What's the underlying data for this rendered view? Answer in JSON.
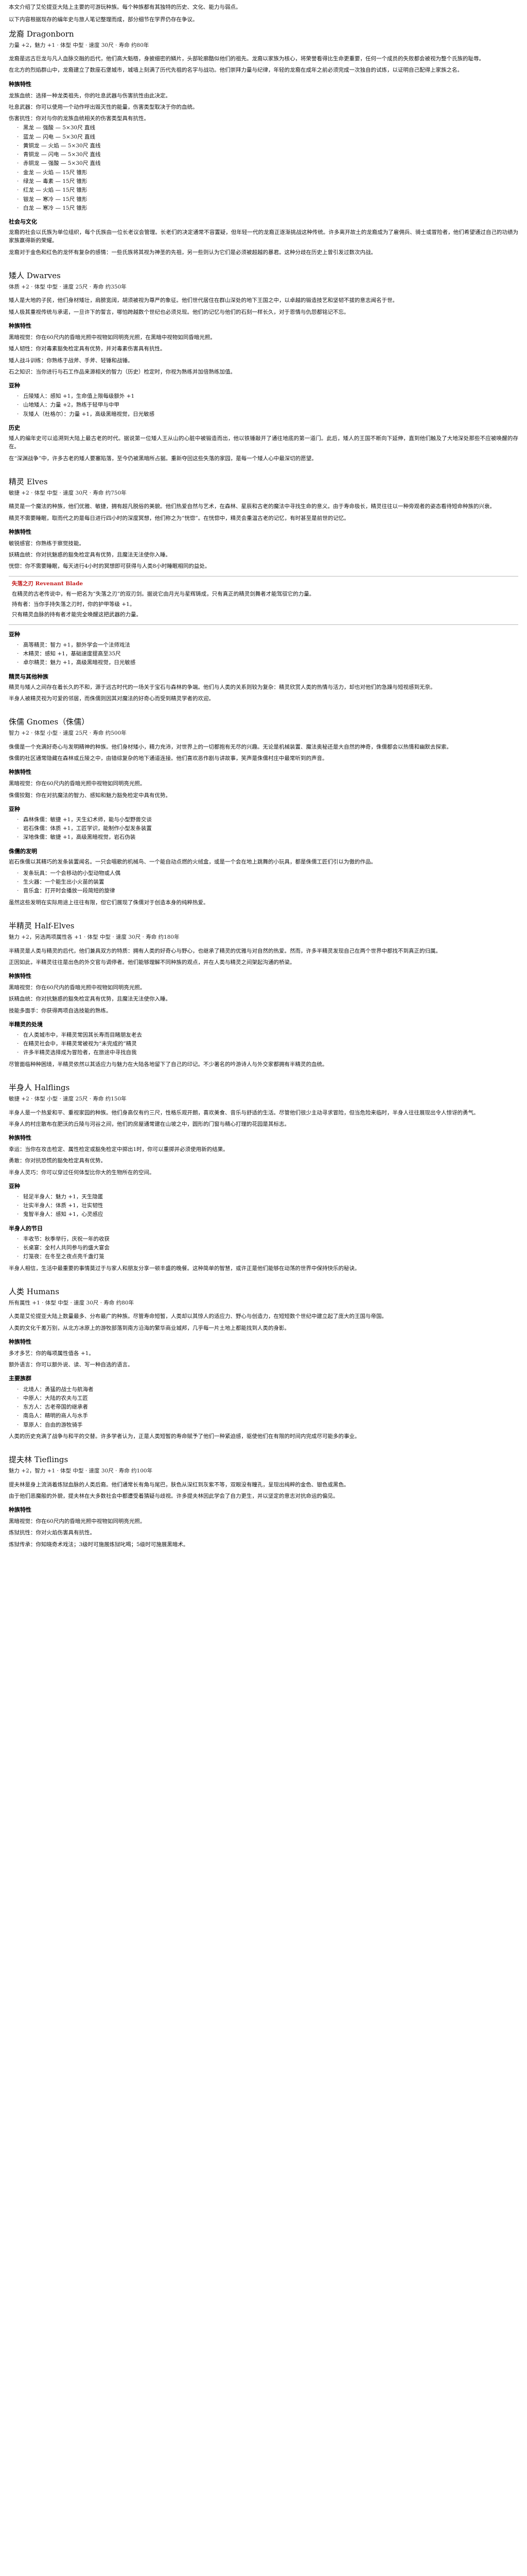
{
  "intro": [
    "本文介绍了艾伦提亚大陆上主要的可游玩种族。每个种族都有其独特的历史、文化、能力与弱点。",
    "以下内容根据现存的编年史与旅人笔记整理而成，部分细节在学界仍存在争议。"
  ],
  "sections": [
    {
      "title": "龙裔 Dragonborn",
      "meta": "力量 +2，魅力 +1 · 体型 中型 · 速度 30尺 · 寿命 约80年",
      "paras": [
        "龙裔是远古巨龙与凡人血脉交融的后代，他们高大魁梧，身披细密的鳞片，头部轮廓酷似他们的祖先。龙裔以家族为核心，将荣誉看得比生命更重要，任何一个成员的失败都会被视为整个氏族的耻辱。",
        "在北方的烈焰群山中，龙裔建立了数座石堡城市，城墙上刻满了历代先祖的名字与战功。他们崇拜力量与纪律，年轻的龙裔在成年之前必须完成一次独自的试炼，以证明自己配得上家族之名。"
      ],
      "blocks": [
        {
          "kind": "sub",
          "text": "种族特性"
        },
        {
          "kind": "feat",
          "text": "龙族血统：选择一种龙类祖先，你的吐息武器与伤害抗性由此决定。"
        },
        {
          "kind": "feat",
          "text": "吐息武器：你可以使用一个动作呼出毁灭性的能量，伤害类型取决于你的血统。"
        },
        {
          "kind": "feat",
          "text": "伤害抗性：你对与你的龙族血统相关的伤害类型具有抗性。"
        },
        {
          "kind": "list",
          "items": [
            "黑龙 — 强酸 — 5×30尺 直线",
            "蓝龙 — 闪电 — 5×30尺 直线",
            "黄铜龙 — 火焰 — 5×30尺 直线",
            "青铜龙 — 闪电 — 5×30尺 直线",
            "赤铜龙 — 强酸 — 5×30尺 直线",
            "金龙 — 火焰 — 15尺 锥形",
            "绿龙 — 毒素 — 15尺 锥形",
            "红龙 — 火焰 — 15尺 锥形",
            "银龙 — 寒冷 — 15尺 锥形",
            "白龙 — 寒冷 — 15尺 锥形"
          ]
        },
        {
          "kind": "sub",
          "text": "社会与文化"
        },
        {
          "kind": "para",
          "text": "龙裔的社会以氏族为单位组织，每个氏族由一位长老议会管理。长老们的决定通常不容置疑，但年轻一代的龙裔正逐渐挑战这种传统。许多离开故土的龙裔成为了雇佣兵、骑士或冒险者，他们希望通过自己的功绩为家族赢得新的荣耀。"
        },
        {
          "kind": "para",
          "text": "龙裔对于金色和红色的龙怀有复杂的感情：一些氏族将其视为神圣的先祖，另一些则认为它们是必须被超越的暴君。这种分歧在历史上曾引发过数次内战。"
        }
      ]
    },
    {
      "title": "矮人 Dwarves",
      "meta": "体质 +2 · 体型 中型 · 速度 25尺 · 寿命 约350年",
      "paras": [
        "矮人是大地的子民，他们身材矮壮，肩膀宽阔，胡须被视为尊严的象征。他们世代居住在群山深处的地下王国之中，以卓越的锻造技艺和坚韧不拔的意志闻名于世。",
        "矮人极其重视传统与承诺，一旦许下的誓言，哪怕跨越数个世纪也必须兑现。他们的记忆与他们的石刻一样长久，对于恩情与仇怨都铭记不忘。"
      ],
      "blocks": [
        {
          "kind": "sub",
          "text": "种族特性"
        },
        {
          "kind": "feat",
          "text": "黑暗视觉：你在60尺内的昏暗光照中视物如同明亮光照，在黑暗中视物如同昏暗光照。"
        },
        {
          "kind": "feat",
          "text": "矮人韧性：你对毒素豁免检定具有优势，并对毒素伤害具有抗性。"
        },
        {
          "kind": "feat",
          "text": "矮人战斗训练：你熟练于战斧、手斧、轻锤和战锤。"
        },
        {
          "kind": "feat",
          "text": "石之知识：当你进行与石工作品来源相关的智力（历史）检定时，你视为熟练并加倍熟练加值。"
        },
        {
          "kind": "sub",
          "text": "亚种"
        },
        {
          "kind": "list",
          "items": [
            "丘陵矮人：感知 +1，生命值上限每级额外 +1",
            "山地矮人：力量 +2，熟练于轻甲与中甲",
            "灰矮人（杜格尔）：力量 +1，高级黑暗视觉，日光敏感"
          ]
        },
        {
          "kind": "sub",
          "text": "历史"
        },
        {
          "kind": "para",
          "text": "矮人的编年史可以追溯到大陆上最古老的时代。据说第一位矮人王从山的心脏中被锻造而出，他以铁锤敲开了通往地底的第一道门。此后，矮人的王国不断向下延伸，直到他们触及了大地深处那些不应被唤醒的存在。"
        },
        {
          "kind": "para",
          "text": "在“深渊战争”中，许多古老的矮人要塞陷落，至今仍被黑暗所占据。重新夺回这些失落的家园，是每一个矮人心中最深切的愿望。"
        }
      ]
    },
    {
      "title": "精灵 Elves",
      "meta": "敏捷 +2 · 体型 中型 · 速度 30尺 · 寿命 约750年",
      "paras": [
        "精灵是一个魔法的种族，他们优雅、敏捷，拥有超凡脱俗的美貌。他们热爱自然与艺术，在森林、星辰和古老的魔法中寻找生命的意义。由于寿命极长，精灵往往以一种旁观者的姿态看待短命种族的兴衰。",
        "精灵不需要睡眠，取而代之的是每日进行四小时的深度冥想，他们称之为“恍惚”。在恍惚中，精灵会重温古老的记忆，有时甚至是前世的记忆。"
      ],
      "blocks": [
        {
          "kind": "sub",
          "text": "种族特性"
        },
        {
          "kind": "feat",
          "text": "敏锐感官：你熟练于察觉技能。"
        },
        {
          "kind": "feat",
          "text": "妖精血统：你对抗魅惑的豁免检定具有优势，且魔法无法使你入睡。"
        },
        {
          "kind": "feat",
          "text": "恍惚：你不需要睡眠，每天进行4小时的冥想即可获得与人类8小时睡眠相同的益处。"
        },
        {
          "kind": "quote",
          "title": "失落之刃 Revenant Blade",
          "paras": [
            "在精灵的古老传说中，有一把名为“失落之刃”的双刃剑。据说它由月光与星辉铸成，只有真正的精灵剑舞者才能驾驭它的力量。",
            "持有者：当你手持失落之刃时，你的护甲等级 +1。",
            "只有精灵血脉的持有者才能完全唤醒这把武器的力量。"
          ]
        },
        {
          "kind": "sub",
          "text": "亚种"
        },
        {
          "kind": "list",
          "items": [
            "高等精灵：智力 +1，额外学会一个法师戏法",
            "木精灵：感知 +1，基础速度提高至35尺",
            "卓尔精灵：魅力 +1，高级黑暗视觉，日光敏感"
          ]
        },
        {
          "kind": "sub",
          "text": "精灵与其他种族"
        },
        {
          "kind": "para",
          "text": "精灵与矮人之间存在着长久的不和，源于远古时代的一场关于宝石与森林的争端。他们与人类的关系则较为复杂：精灵欣赏人类的热情与活力，却也对他们的急躁与短视感到无奈。"
        },
        {
          "kind": "para",
          "text": "半身人被精灵视为可爱的邻居，而侏儒则因其对魔法的好奇心而受到精灵学者的欢迎。"
        }
      ]
    },
    {
      "title": "侏儒 Gnomes（侏儒）",
      "meta": "智力 +2 · 体型 小型 · 速度 25尺 · 寿命 约500年",
      "paras": [
        "侏儒是一个充满好奇心与发明精神的种族。他们身材矮小，精力充沛，对世界上的一切都抱有无尽的兴趣。无论是机械装置、魔法奥秘还是大自然的神奇，侏儒都会以热情和幽默去探索。",
        "侏儒的社区通常隐藏在森林或丘陵之中，由错综复杂的地下通道连接。他们喜欢恶作剧与讲故事，笑声是侏儒村庄中最常听到的声音。"
      ],
      "blocks": [
        {
          "kind": "sub",
          "text": "种族特性"
        },
        {
          "kind": "feat",
          "text": "黑暗视觉：你在60尺内的昏暗光照中视物如同明亮光照。"
        },
        {
          "kind": "feat",
          "text": "侏儒狡黠：你在对抗魔法的智力、感知和魅力豁免检定中具有优势。"
        },
        {
          "kind": "sub",
          "text": "亚种"
        },
        {
          "kind": "list",
          "items": [
            "森林侏儒：敏捷 +1，天生幻术师，能与小型野兽交谈",
            "岩石侏儒：体质 +1，工匠学识，能制作小型发条装置",
            "深地侏儒：敏捷 +1，高级黑暗视觉，岩石伪装"
          ]
        },
        {
          "kind": "sub",
          "text": "侏儒的发明"
        },
        {
          "kind": "para",
          "text": "岩石侏儒以其精巧的发条装置闻名。一只会唱歌的机械鸟、一个能自动点燃的火绒盒，或是一个会在地上跳舞的小玩具，都是侏儒工匠们引以为傲的作品。"
        },
        {
          "kind": "list",
          "items": [
            "发条玩具：一个会移动的小型动物或人偶",
            "生火器：一个能生出小火苗的装置",
            "音乐盒：打开时会播放一段简短的旋律"
          ]
        },
        {
          "kind": "para",
          "text": "虽然这些发明在实际用途上往往有限，但它们展现了侏儒对于创造本身的纯粹热爱。"
        }
      ]
    },
    {
      "title": "半精灵 Half-Elves",
      "meta": "魅力 +2，另选两项属性各 +1 · 体型 中型 · 速度 30尺 · 寿命 约180年",
      "paras": [
        "半精灵是人类与精灵的后代，他们兼具双方的特质：拥有人类的好奇心与野心，也继承了精灵的优雅与对自然的热爱。然而，许多半精灵发现自己在两个世界中都找不到真正的归属。",
        "正因如此，半精灵往往是出色的外交官与调停者。他们能够理解不同种族的观点，并在人类与精灵之间架起沟通的桥梁。"
      ],
      "blocks": [
        {
          "kind": "sub",
          "text": "种族特性"
        },
        {
          "kind": "feat",
          "text": "黑暗视觉：你在60尺内的昏暗光照中视物如同明亮光照。"
        },
        {
          "kind": "feat",
          "text": "妖精血统：你对抗魅惑的豁免检定具有优势，且魔法无法使你入睡。"
        },
        {
          "kind": "feat",
          "text": "技能多面手：你获得两项自选技能的熟练。"
        },
        {
          "kind": "sub",
          "text": "半精灵的处境"
        },
        {
          "kind": "list",
          "items": [
            "在人类城市中，半精灵常因其长寿而目睹朋友老去",
            "在精灵社会中，半精灵常被视为“未完成的”精灵",
            "许多半精灵选择成为冒险者，在旅途中寻找自我"
          ]
        },
        {
          "kind": "para",
          "text": "尽管面临种种困境，半精灵依然以其适应力与魅力在大陆各地留下了自己的印记。不少著名的吟游诗人与外交家都拥有半精灵的血统。"
        }
      ]
    },
    {
      "title": "半身人 Halflings",
      "meta": "敏捷 +2 · 体型 小型 · 速度 25尺 · 寿命 约150年",
      "paras": [
        "半身人是一个热爱和平、重视家园的种族。他们身高仅有约三尺，性格乐观开朗，喜欢美食、音乐与舒适的生活。尽管他们很少主动寻求冒险，但当危险来临时，半身人往往展现出令人惊讶的勇气。",
        "半身人的村庄散布在肥沃的丘陵与河谷之间，他们的房屋通常建在山坡之中，圆形的门窗与精心打理的花园是其标志。"
      ],
      "blocks": [
        {
          "kind": "sub",
          "text": "种族特性"
        },
        {
          "kind": "feat",
          "text": "幸运：当你在攻击检定、属性检定或豁免检定中掷出1时，你可以重掷并必须使用新的结果。"
        },
        {
          "kind": "feat",
          "text": "勇敢：你对抗恐慌的豁免检定具有优势。"
        },
        {
          "kind": "feat",
          "text": "半身人灵巧：你可以穿过任何体型比你大的生物所在的空间。"
        },
        {
          "kind": "sub",
          "text": "亚种"
        },
        {
          "kind": "list",
          "items": [
            "轻足半身人：魅力 +1，天生隐匿",
            "壮实半身人：体质 +1，壮实韧性",
            "鬼智半身人：感知 +1，心灵感应"
          ]
        },
        {
          "kind": "sub",
          "text": "半身人的节日"
        },
        {
          "kind": "list",
          "items": [
            "丰收节：秋季举行，庆祝一年的收获",
            "长桌宴：全村人共同参与的盛大宴会",
            "灯笼夜：在冬至之夜点亮千盏灯笼"
          ]
        },
        {
          "kind": "para",
          "text": "半身人相信，生活中最重要的事情莫过于与家人和朋友分享一顿丰盛的晚餐。这种简单的智慧，或许正是他们能够在动荡的世界中保持快乐的秘诀。"
        }
      ]
    },
    {
      "title": "人类 Humans",
      "meta": "所有属性 +1 · 体型 中型 · 速度 30尺 · 寿命 约80年",
      "paras": [
        "人类是艾伦提亚大陆上数量最多、分布最广的种族。尽管寿命短暂，人类却以其惊人的适应力、野心与创造力，在短短数个世纪中建立起了庞大的王国与帝国。",
        "人类的文化千差万别，从北方冰原上的游牧部落到南方沿海的繁华商业城邦，几乎每一片土地上都能找到人类的身影。"
      ],
      "blocks": [
        {
          "kind": "sub",
          "text": "种族特性"
        },
        {
          "kind": "feat",
          "text": "多才多艺：你的每项属性值各 +1。"
        },
        {
          "kind": "feat",
          "text": "额外语言：你可以额外说、读、写一种自选的语言。"
        },
        {
          "kind": "sub",
          "text": "主要族群"
        },
        {
          "kind": "list",
          "items": [
            "北境人：勇猛的战士与航海者",
            "中原人：大陆的农夫与工匠",
            "东方人：古老帝国的继承者",
            "南岛人：精明的商人与水手",
            "草原人：自由的游牧骑手"
          ]
        },
        {
          "kind": "para",
          "text": "人类的历史充满了战争与和平的交替。许多学者认为，正是人类短暂的寿命赋予了他们一种紧迫感，驱使他们在有限的时间内完成尽可能多的事业。"
        }
      ]
    },
    {
      "title": "提夫林 Tieflings",
      "meta": "魅力 +2，智力 +1 · 体型 中型 · 速度 30尺 · 寿命 约100年",
      "paras": [
        "提夫林是身上流淌着炼狱血脉的人类后裔。他们通常长有角与尾巴，肤色从深红到灰紫不等，双眼没有瞳孔，呈现出纯粹的金色、银色或黑色。",
        "由于他们恶魔般的外貌，提夫林在大多数社会中都遭受着猜疑与歧视。许多提夫林因此学会了自力更生，并以坚定的意志对抗命运的偏见。"
      ],
      "blocks": [
        {
          "kind": "sub",
          "text": "种族特性"
        },
        {
          "kind": "feat",
          "text": "黑暗视觉：你在60尺内的昏暗光照中视物如同明亮光照。"
        },
        {
          "kind": "feat",
          "text": "炼狱抗性：你对火焰伤害具有抗性。"
        },
        {
          "kind": "feat",
          "text": "炼狱传承：你知晓奇术戏法；3级时可施展炼狱叱喝；5级时可施展黑暗术。"
        }
      ]
    }
  ]
}
